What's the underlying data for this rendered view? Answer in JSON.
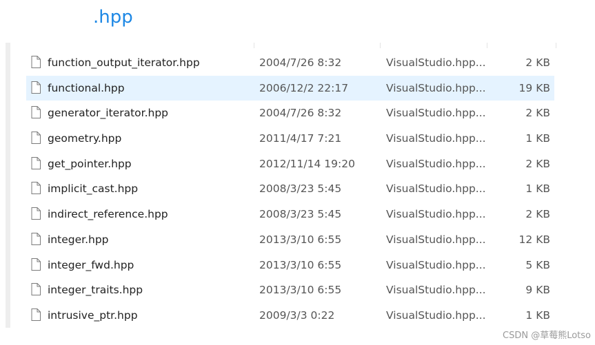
{
  "heading": ".hpp",
  "files": [
    {
      "name": "function_output_iterator.hpp",
      "date": "2004/7/26 8:32",
      "type": "VisualStudio.hpp...",
      "size": "2 KB"
    },
    {
      "name": "functional.hpp",
      "date": "2006/12/2 22:17",
      "type": "VisualStudio.hpp...",
      "size": "19 KB"
    },
    {
      "name": "generator_iterator.hpp",
      "date": "2004/7/26 8:32",
      "type": "VisualStudio.hpp...",
      "size": "2 KB"
    },
    {
      "name": "geometry.hpp",
      "date": "2011/4/17 7:21",
      "type": "VisualStudio.hpp...",
      "size": "1 KB"
    },
    {
      "name": "get_pointer.hpp",
      "date": "2012/11/14 19:20",
      "type": "VisualStudio.hpp...",
      "size": "2 KB"
    },
    {
      "name": "implicit_cast.hpp",
      "date": "2008/3/23 5:45",
      "type": "VisualStudio.hpp...",
      "size": "1 KB"
    },
    {
      "name": "indirect_reference.hpp",
      "date": "2008/3/23 5:45",
      "type": "VisualStudio.hpp...",
      "size": "2 KB"
    },
    {
      "name": "integer.hpp",
      "date": "2013/3/10 6:55",
      "type": "VisualStudio.hpp...",
      "size": "12 KB"
    },
    {
      "name": "integer_fwd.hpp",
      "date": "2013/3/10 6:55",
      "type": "VisualStudio.hpp...",
      "size": "5 KB"
    },
    {
      "name": "integer_traits.hpp",
      "date": "2013/3/10 6:55",
      "type": "VisualStudio.hpp...",
      "size": "9 KB"
    },
    {
      "name": "intrusive_ptr.hpp",
      "date": "2009/3/3 0:22",
      "type": "VisualStudio.hpp...",
      "size": "1 KB"
    }
  ],
  "watermark": "CSDN @草莓熊Lotso",
  "icons": {
    "file": "file-icon"
  },
  "colors": {
    "heading": "#1e88e5",
    "selected_row": "#e5f3ff"
  }
}
